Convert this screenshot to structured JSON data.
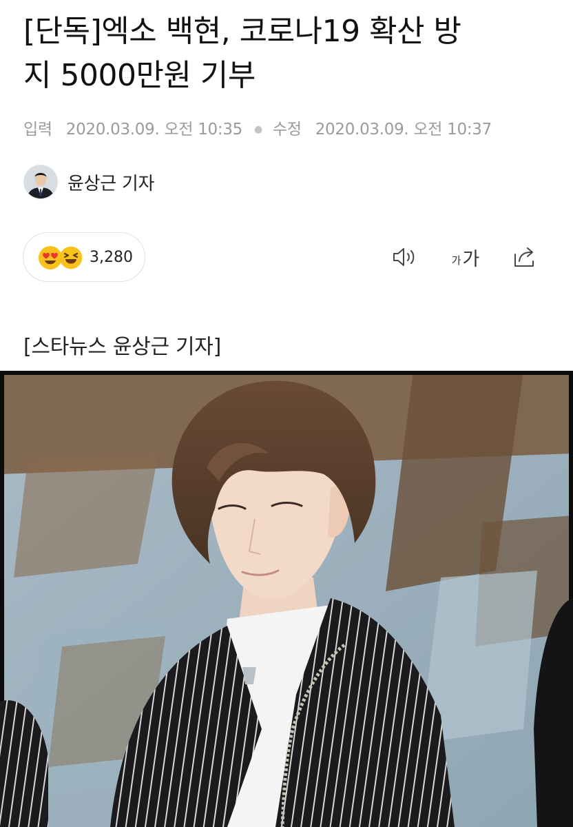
{
  "article": {
    "headline_line1": "[단독]엑소 백현, 코로나19 확산 방",
    "headline_line2": "지 5000만원 기부",
    "meta": {
      "published_label": "입력",
      "published_at": "2020.03.09. 오전 10:35",
      "modified_label": "수정",
      "modified_at": "2020.03.09. 오전 10:37"
    },
    "reporter": {
      "name": "윤상근 기자",
      "avatar_icon": "reporter-avatar"
    },
    "reactions": {
      "icons": [
        "heart-eyes-emoji",
        "laughing-emoji"
      ],
      "count": "3,280"
    },
    "tools": {
      "tts_icon": "speaker-icon",
      "font_small": "가",
      "font_large": "가",
      "share_icon": "share-icon"
    },
    "photo_caption": "[스타뉴스 윤상근 기자]",
    "photo_icon": "article-photo"
  },
  "colors": {
    "text_primary": "#111111",
    "text_meta": "#9b9b9b",
    "pill_border": "#e1e1e1",
    "emoji_yellow": "#f8c21c",
    "heart_red": "#e8372e"
  }
}
